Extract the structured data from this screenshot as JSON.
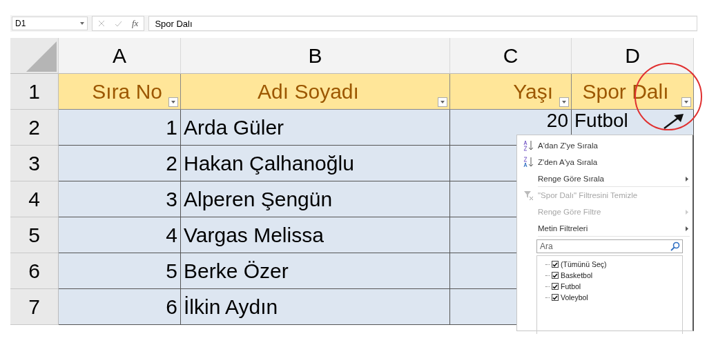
{
  "formula_bar": {
    "name_box": "D1",
    "fx": "fx",
    "value": "Spor Dalı"
  },
  "columns": [
    "A",
    "B",
    "C",
    "D"
  ],
  "header_row": {
    "number": "1",
    "cells": [
      "Sıra No",
      "Adı Soyadı",
      "Yaşı",
      "Spor Dalı"
    ]
  },
  "rows": [
    {
      "number": "2",
      "no": "1",
      "name": "Arda Güler",
      "age": "20",
      "sport": "Futbol"
    },
    {
      "number": "3",
      "no": "2",
      "name": "Hakan Çalhanoğlu"
    },
    {
      "number": "4",
      "no": "3",
      "name": "Alperen Şengün"
    },
    {
      "number": "5",
      "no": "4",
      "name": "Vargas Melissa"
    },
    {
      "number": "6",
      "no": "5",
      "name": "Berke Özer"
    },
    {
      "number": "7",
      "no": "6",
      "name": "İlkin Aydın"
    }
  ],
  "filter_menu": {
    "items": [
      {
        "kind": "sort_az",
        "label": "A'dan Z'ye Sırala",
        "disabled": false,
        "submenu": false,
        "separator_after": false
      },
      {
        "kind": "sort_za",
        "label": "Z'den A'ya Sırala",
        "disabled": false,
        "submenu": false,
        "separator_after": false
      },
      {
        "kind": "plain",
        "label": "Renge Göre Sırala",
        "disabled": false,
        "submenu": true,
        "separator_after": true
      },
      {
        "kind": "clear_filter",
        "label": "\"Spor Dalı\" Filtresini Temizle",
        "disabled": true,
        "submenu": false,
        "separator_after": false
      },
      {
        "kind": "plain",
        "label": "Renge Göre Filtre",
        "disabled": true,
        "submenu": true,
        "separator_after": false
      },
      {
        "kind": "plain",
        "label": "Metin Filtreleri",
        "disabled": false,
        "submenu": true,
        "separator_after": true
      }
    ],
    "search": {
      "placeholder": "Ara"
    },
    "values": [
      {
        "label": "(Tümünü Seç)",
        "checked": true
      },
      {
        "label": "Basketbol",
        "checked": true
      },
      {
        "label": "Futbol",
        "checked": true
      },
      {
        "label": "Voleybol",
        "checked": true
      }
    ]
  }
}
